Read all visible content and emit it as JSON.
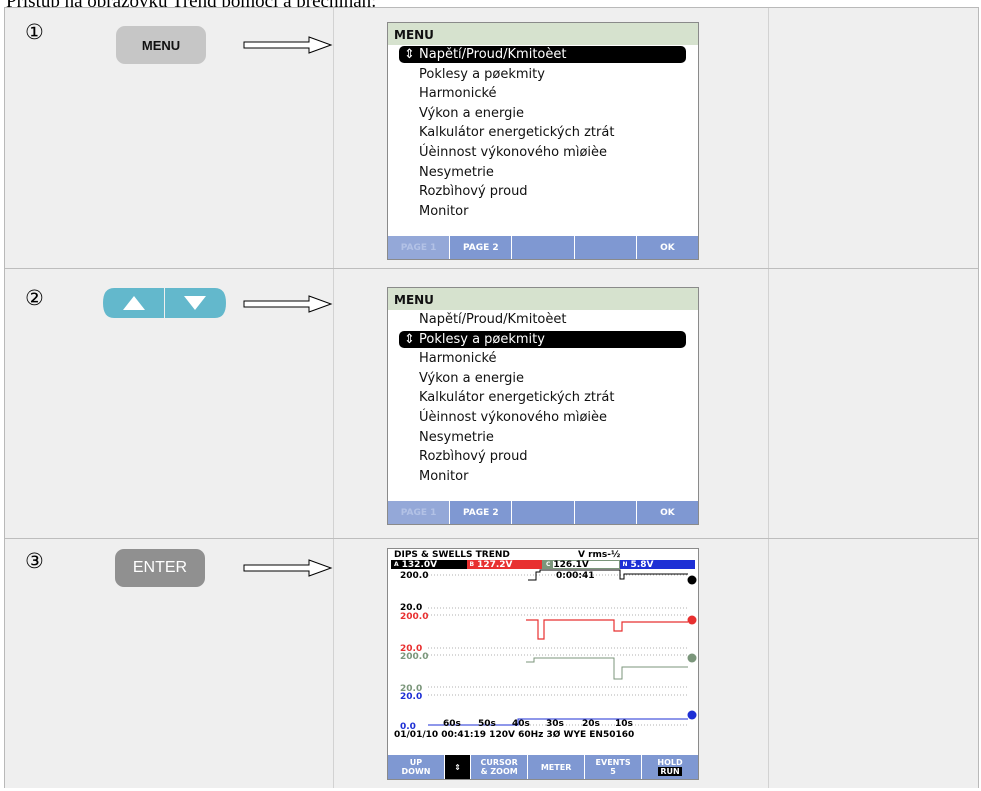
{
  "header_text": "Přístup na obrazovku Trend pomocí a přechínán:",
  "steps": [
    {
      "number": "①",
      "button": "MENU",
      "screen": {
        "title": "MENU",
        "items": [
          "Napětí/Proud/Kmitoèet",
          "Poklesy a pøekmity",
          "Harmonické",
          "Výkon a energie",
          "Kalkulátor energetických ztrát",
          "Úèinnost výkonového mìøièe",
          "Nesymetrie",
          "Rozbìhový proud",
          "Monitor"
        ],
        "selected_index": 0,
        "selection_mark": "⇕",
        "softkeys": [
          "PAGE 1",
          "PAGE 2",
          "",
          "",
          "OK"
        ]
      }
    },
    {
      "number": "②",
      "button": "up-down",
      "screen": {
        "title": "MENU",
        "items": [
          "Napětí/Proud/Kmitoèet",
          "Poklesy a pøekmity",
          "Harmonické",
          "Výkon a energie",
          "Kalkulátor energetických ztrát",
          "Úèinnost výkonového mìøièe",
          "Nesymetrie",
          "Rozbìhový proud",
          "Monitor"
        ],
        "selected_index": 1,
        "selection_mark": "⇕",
        "softkeys": [
          "PAGE 1",
          "PAGE 2",
          "",
          "",
          "OK"
        ]
      }
    },
    {
      "number": "③",
      "button": "ENTER",
      "scope": {
        "title": "DIPS & SWELLS TREND",
        "mode": "V rms-½",
        "readings": [
          {
            "tag": "A",
            "value": "132.0V"
          },
          {
            "tag": "B",
            "value": "127.2V"
          },
          {
            "tag": "C",
            "value": "126.1V"
          },
          {
            "tag": "N",
            "value": "5.8V"
          }
        ],
        "timer": "0:00:41",
        "scale_labels": {
          "a_top": "200.0",
          "a_bot": "20.0",
          "b_top": "200.0",
          "b_bot": "20.0",
          "c_top": "200.0",
          "c_bot": "20.0",
          "n_top": "20.0",
          "n_bot": "0.0"
        },
        "time_ticks": [
          "60s",
          "50s",
          "40s",
          "30s",
          "20s",
          "10s"
        ],
        "status": "01/01/10  00:41:19      120V  60Hz 3Ø WYE    EN50160",
        "softkeys": [
          {
            "top": "UP",
            "bottom": "DOWN"
          },
          {
            "top": "⇕",
            "bottom": ""
          },
          {
            "top": "CURSOR",
            "bottom": "& ZOOM"
          },
          {
            "top": "METER",
            "bottom": ""
          },
          {
            "top": "EVENTS",
            "bottom": "5"
          },
          {
            "top": "HOLD",
            "bottom": "RUN"
          }
        ]
      }
    }
  ],
  "colors": {
    "a": "#000000",
    "b": "#e83030",
    "c": "#7b967b",
    "n": "#1d2fd5",
    "softkey": "#7f98d2"
  }
}
